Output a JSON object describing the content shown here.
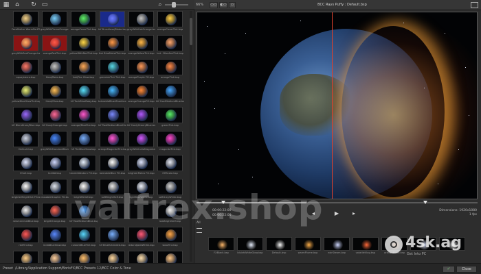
{
  "left_panel": {
    "toolbar_icons": [
      "grid-view-icon",
      "home-icon",
      "refresh-icon",
      "folder-icon",
      "search-icon",
      "slider-icon"
    ],
    "grid": [
      [
        "FaceMelter WarmPortTint.bsp",
        "greyWithFlameOrange.bsp",
        "orangeCoverTint.bsp",
        "hlf Brushless/Blade.bsp",
        "greyWithHotOrange.bsp",
        "orangeCoverTint.bsp"
      ],
      [
        "greyWithRedOrange.bsp",
        "orangeRedTint.bsp",
        "yellowWithRedTint.bsp",
        "Hot BlueMetalTint.bsp",
        "orangeYellowTint.bsp",
        "hot - BlueAndTint.bsp"
      ],
      [
        "aqua/sierra.bsp",
        "Heat/Beta.bsp",
        "hot/Fire Glow.bsp",
        "greenishTint Tint.bsp",
        "orangePurple FG.bsp",
        "orangeTint.bsp"
      ],
      [
        "yellowBlueGlowTint.bsp",
        "Heat/Glow.bsp",
        "hlf TuckBlueBaby.bsp",
        "tolerableBlue-BlueLine.bsp",
        "orangeOrangeFG.bsp",
        "hlf CoolMediumBlue.bsp"
      ],
      [
        "hlf Blendfrom/Blue.bsp",
        "hlf CoolyOrange.bsp",
        "orange/BlueFire.bsp",
        "hlf TwoMediumBlue2.bsp",
        "hlf CoolyGreen/Blue.bsp",
        "greenTint.bsp"
      ],
      [
        "Default.bsp",
        "greyWithStandardBlu.bsp",
        "hlf TiniBlueGlow.bsp",
        "orangeMagentaTint.bsp",
        "greyWithIndiaMagenta.bsp",
        "magentaTint.bsp"
      ],
      [
        "VColt.bsp",
        "IndiLW.bsp",
        "tenderWestern FG.bsp",
        "tolerableBlue FG.bsp",
        "brighterMetro FG.bsp",
        "OffScale.bsp"
      ],
      [
        "brighterBrightOut FG.bsp",
        "reusableGraphic FG.bsp",
        "brightRelief.bsp",
        "softBrightSelf.bsp",
        "lightBlueWhite.bsp",
        "softGreyWhite.bsp"
      ],
      [
        "newCarnivalBlue.bsp",
        "brightOrange.bsp",
        "hlf TwoMediumBlue.bsp",
        "",
        "",
        "lowBrightSelf.bsp"
      ],
      [
        "redTint.bsp",
        "indiaBlueGlow.bsp",
        "customBlueTint.bsp",
        "hlf BlueExtended.bsp",
        "redandJadeWhite.bsp",
        "slowTint.bsp"
      ],
      [
        "",
        "",
        "",
        "",
        "",
        ""
      ]
    ]
  },
  "viewer": {
    "zoom": "66%",
    "view_buttons": [
      "▭▭",
      "◐▭",
      "▭"
    ],
    "title": "BCC Rays Puffy : Default.bsp",
    "timecode_current": "00:00:22:00",
    "timecode_total": "00:00:22:00",
    "dimensions": "Dimensions: 1920x1080",
    "frame": "1 fps",
    "strip_label": "All",
    "strip": [
      "FXBlack.bsp",
      "bluishWhiteGlow.bsp",
      "Default.bsp",
      "warmPlume.bsp",
      "noirSteam.bsp",
      "volatileVlog.bsp",
      "orangeBlaze.bsp",
      "",
      ""
    ]
  },
  "status": {
    "path_label": "Preset",
    "path": "/Library/Application Support/BorisFX/BCC Presets 12/BCC Color & Tone",
    "apply_label": "✓",
    "close_label": "Close"
  },
  "watermark": {
    "main": "valfrex.shop",
    "badge": "4sk.ag",
    "badge_sub": "Get Into PC"
  },
  "colors": {
    "accent_split": "#e0412c",
    "apply_green": "#7fd67f"
  }
}
